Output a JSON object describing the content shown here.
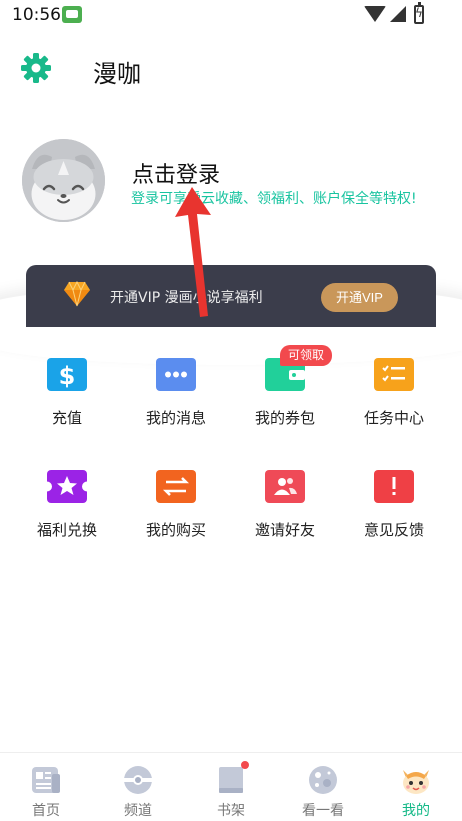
{
  "status_bar": {
    "time": "10:56",
    "icons": [
      "app-notification-icon",
      "wifi-icon",
      "signal-icon",
      "battery-charging-icon"
    ]
  },
  "header": {
    "title": "漫咖",
    "settings_icon": "gear-icon",
    "accent_color": "#19b98a"
  },
  "profile": {
    "login_title": "点击登录",
    "login_subtitle": "登录可享受云收藏、领福利、账户保全等特权!",
    "avatar_icon": "default-avatar-icon"
  },
  "vip": {
    "text": "开通VIP 漫画小说享福利",
    "button_label": "开通VIP",
    "icon": "diamond-icon",
    "button_color": "#c9975a",
    "banner_color": "#3b3d4b"
  },
  "grid": {
    "items": [
      {
        "label": "充值",
        "icon": "dollar-icon",
        "color": "#1aa3e8"
      },
      {
        "label": "我的消息",
        "icon": "message-dots-icon",
        "color": "#5b8def"
      },
      {
        "label": "我的券包",
        "icon": "wallet-icon",
        "color": "#21d09a",
        "badge": "可领取"
      },
      {
        "label": "任务中心",
        "icon": "task-list-icon",
        "color": "#f7a21b"
      },
      {
        "label": "福利兑换",
        "icon": "star-ticket-icon",
        "color": "#9b23e6"
      },
      {
        "label": "我的购买",
        "icon": "exchange-arrows-icon",
        "color": "#f2641f"
      },
      {
        "label": "邀请好友",
        "icon": "friends-icon",
        "color": "#ef4a57"
      },
      {
        "label": "意见反馈",
        "icon": "exclamation-icon",
        "color": "#ef4045"
      }
    ]
  },
  "bottom_nav": {
    "items": [
      {
        "label": "首页",
        "icon": "news-icon",
        "active": false
      },
      {
        "label": "频道",
        "icon": "channel-disc-icon",
        "active": false
      },
      {
        "label": "书架",
        "icon": "bookshelf-icon",
        "active": false,
        "has_dot": true
      },
      {
        "label": "看一看",
        "icon": "planet-icon",
        "active": false
      },
      {
        "label": "我的",
        "icon": "cat-avatar-icon",
        "active": true
      }
    ],
    "active_color": "#12b886"
  }
}
